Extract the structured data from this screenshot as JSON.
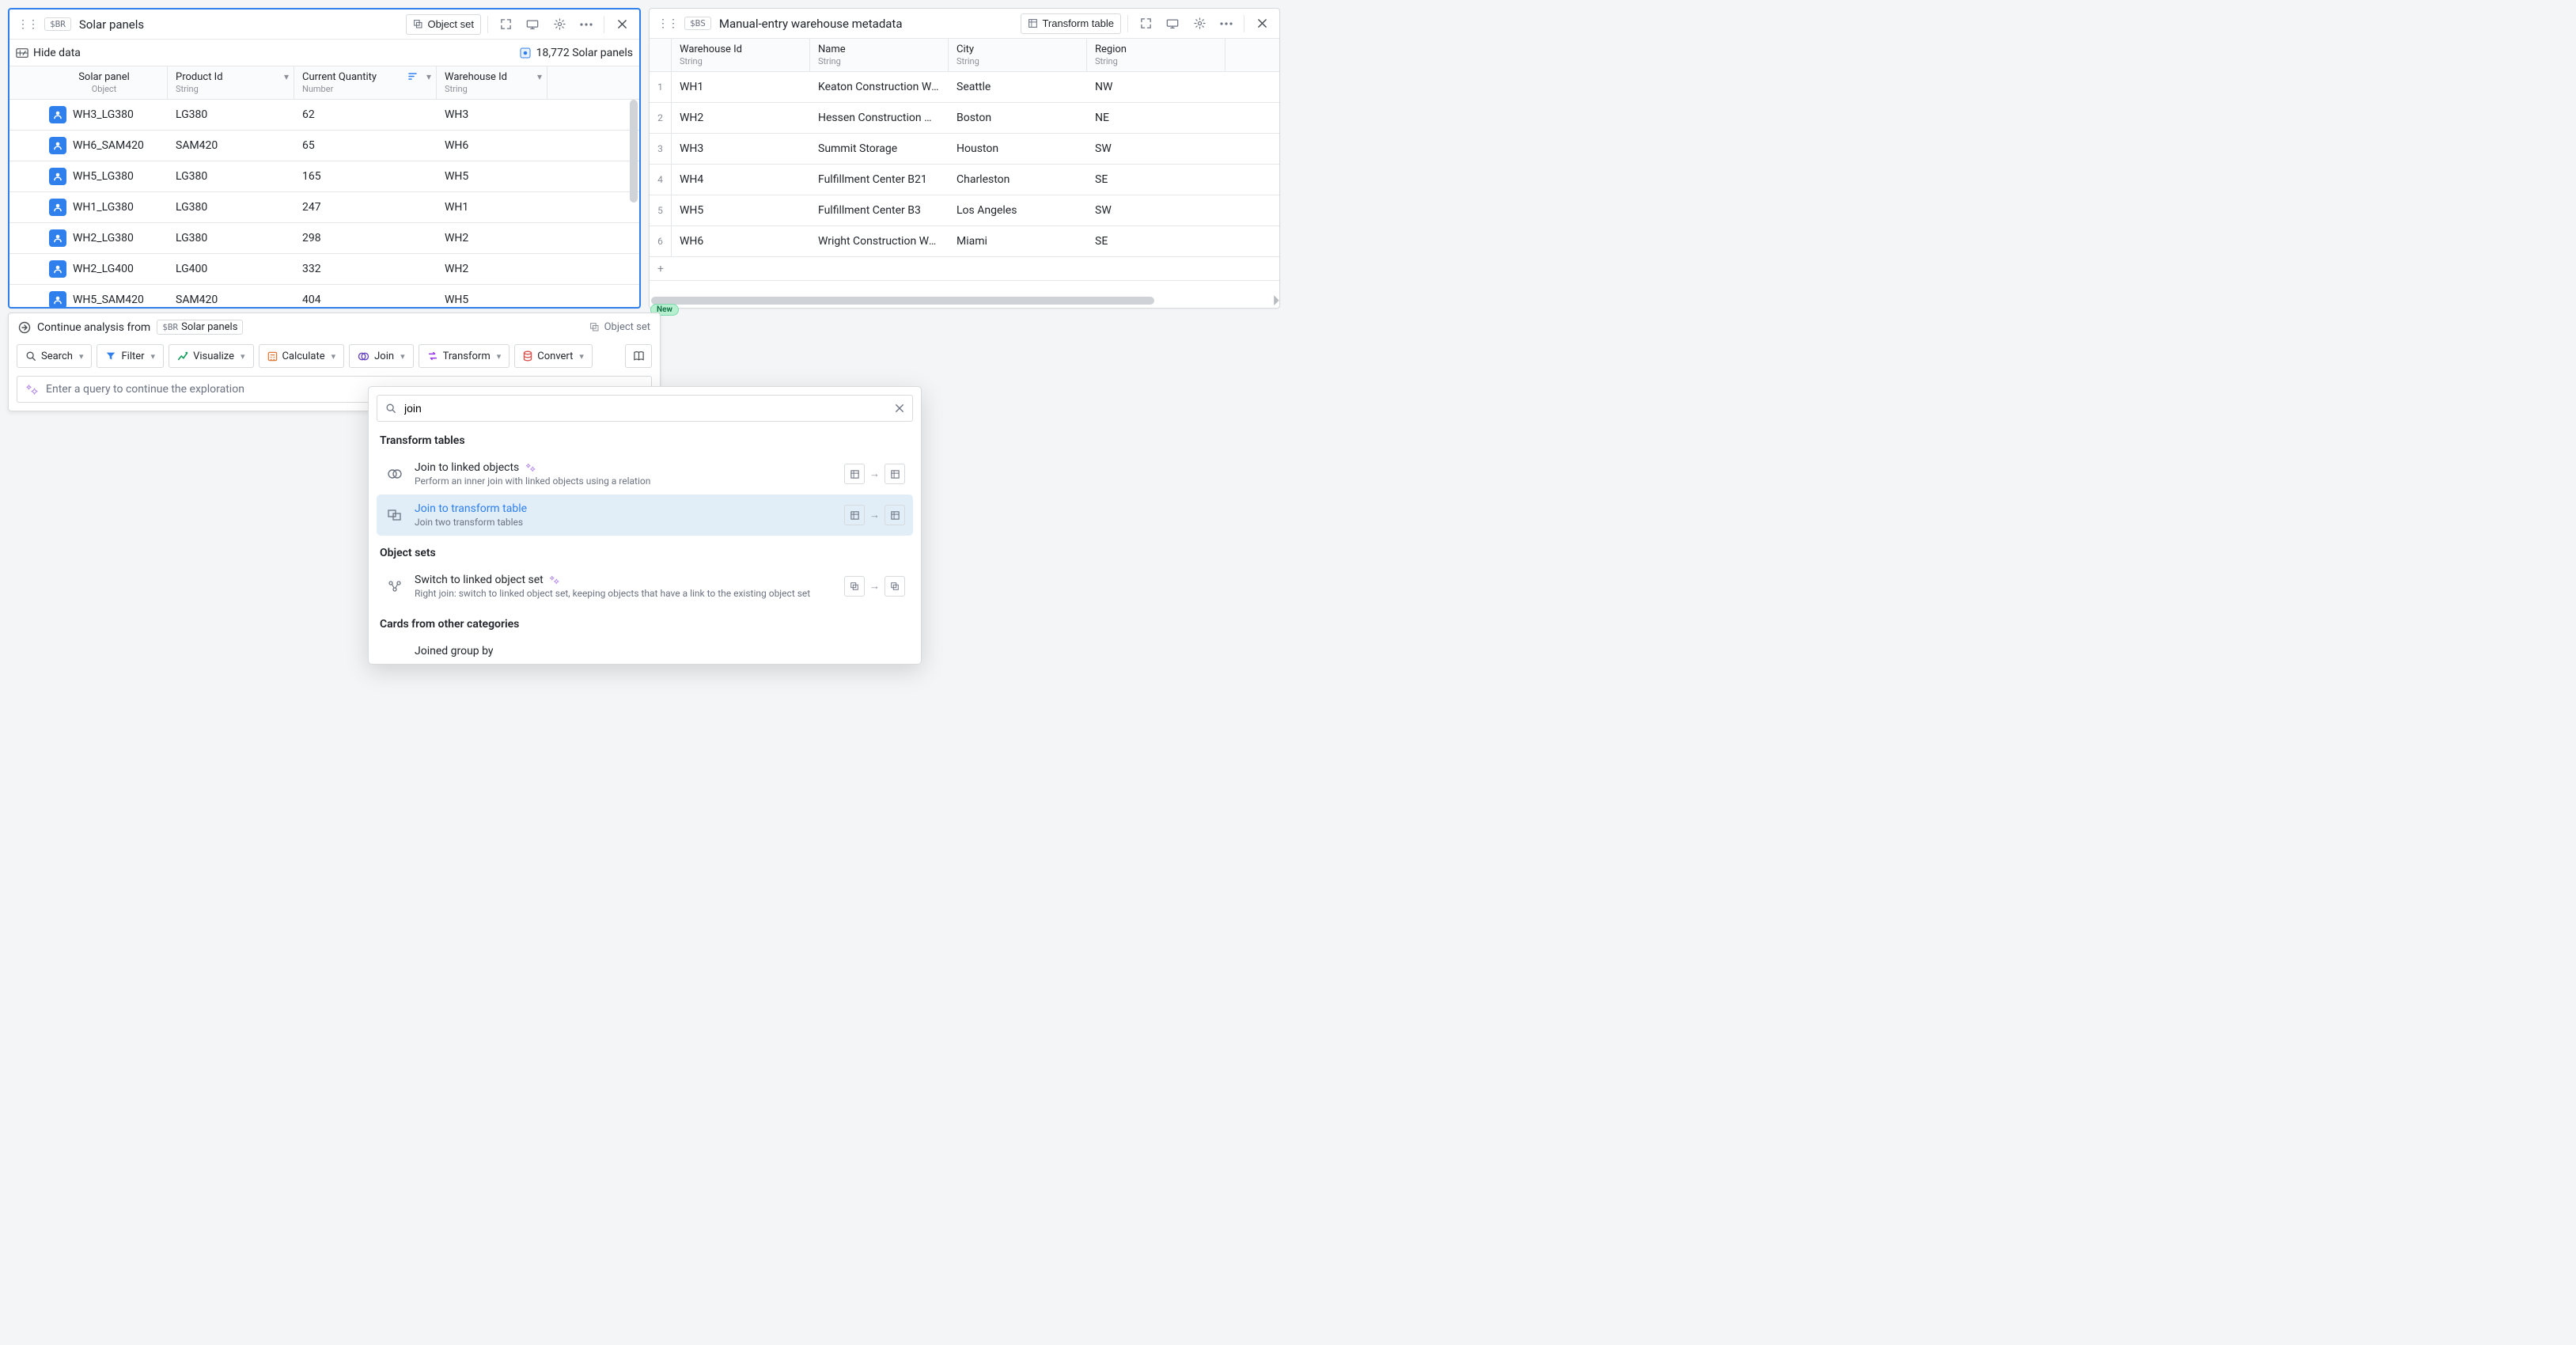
{
  "left_panel": {
    "chip": "$BR",
    "title": "Solar panels",
    "object_set_btn": "Object set",
    "hide_data": "Hide data",
    "count_label": "18,772 Solar panels",
    "columns": [
      {
        "name": "Solar panel",
        "type": "Object"
      },
      {
        "name": "Product Id",
        "type": "String"
      },
      {
        "name": "Current Quantity",
        "type": "Number"
      },
      {
        "name": "Warehouse Id",
        "type": "String"
      }
    ],
    "rows": [
      {
        "name": "WH3_LG380",
        "product": "LG380",
        "qty": "62",
        "wh": "WH3"
      },
      {
        "name": "WH6_SAM420",
        "product": "SAM420",
        "qty": "65",
        "wh": "WH6"
      },
      {
        "name": "WH5_LG380",
        "product": "LG380",
        "qty": "165",
        "wh": "WH5"
      },
      {
        "name": "WH1_LG380",
        "product": "LG380",
        "qty": "247",
        "wh": "WH1"
      },
      {
        "name": "WH2_LG380",
        "product": "LG380",
        "qty": "298",
        "wh": "WH2"
      },
      {
        "name": "WH2_LG400",
        "product": "LG400",
        "qty": "332",
        "wh": "WH2"
      },
      {
        "name": "WH5_SAM420",
        "product": "SAM420",
        "qty": "404",
        "wh": "WH5"
      }
    ]
  },
  "right_panel": {
    "chip": "$BS",
    "title": "Manual-entry warehouse metadata",
    "transform_btn": "Transform table",
    "columns": [
      {
        "name": "Warehouse Id",
        "type": "String"
      },
      {
        "name": "Name",
        "type": "String"
      },
      {
        "name": "City",
        "type": "String"
      },
      {
        "name": "Region",
        "type": "String"
      }
    ],
    "rows": [
      {
        "id": "WH1",
        "name": "Keaton Construction Wa…",
        "city": "Seattle",
        "region": "NW"
      },
      {
        "id": "WH2",
        "name": "Hessen Construction W…",
        "city": "Boston",
        "region": "NE"
      },
      {
        "id": "WH3",
        "name": "Summit Storage",
        "city": "Houston",
        "region": "SW"
      },
      {
        "id": "WH4",
        "name": "Fulfillment Center B21",
        "city": "Charleston",
        "region": "SE"
      },
      {
        "id": "WH5",
        "name": "Fulfillment Center B3",
        "city": "Los Angeles",
        "region": "SW"
      },
      {
        "id": "WH6",
        "name": "Wright Construction Wa…",
        "city": "Miami",
        "region": "SE"
      }
    ]
  },
  "analysis": {
    "header": "Continue analysis from",
    "source_chip": "$BR",
    "source_name": "Solar panels",
    "object_set": "Object set",
    "tools": {
      "search": "Search",
      "filter": "Filter",
      "visualize": "Visualize",
      "calculate": "Calculate",
      "join": "Join",
      "transform": "Transform",
      "convert": "Convert"
    },
    "query_placeholder": "Enter a query to continue the exploration"
  },
  "popover": {
    "search_value": "join",
    "section1": "Transform tables",
    "item1": {
      "title": "Join to linked objects",
      "desc": "Perform an inner join with linked objects using a relation"
    },
    "item2": {
      "title": "Join to transform table",
      "desc": "Join two transform tables"
    },
    "section2": "Object sets",
    "item3": {
      "title": "Switch to linked object set",
      "desc": "Right join: switch to linked object set, keeping objects that have a link to the existing object set"
    },
    "section3": "Cards from other categories",
    "item4": {
      "title": "Joined group by"
    }
  },
  "new_badge": "New"
}
